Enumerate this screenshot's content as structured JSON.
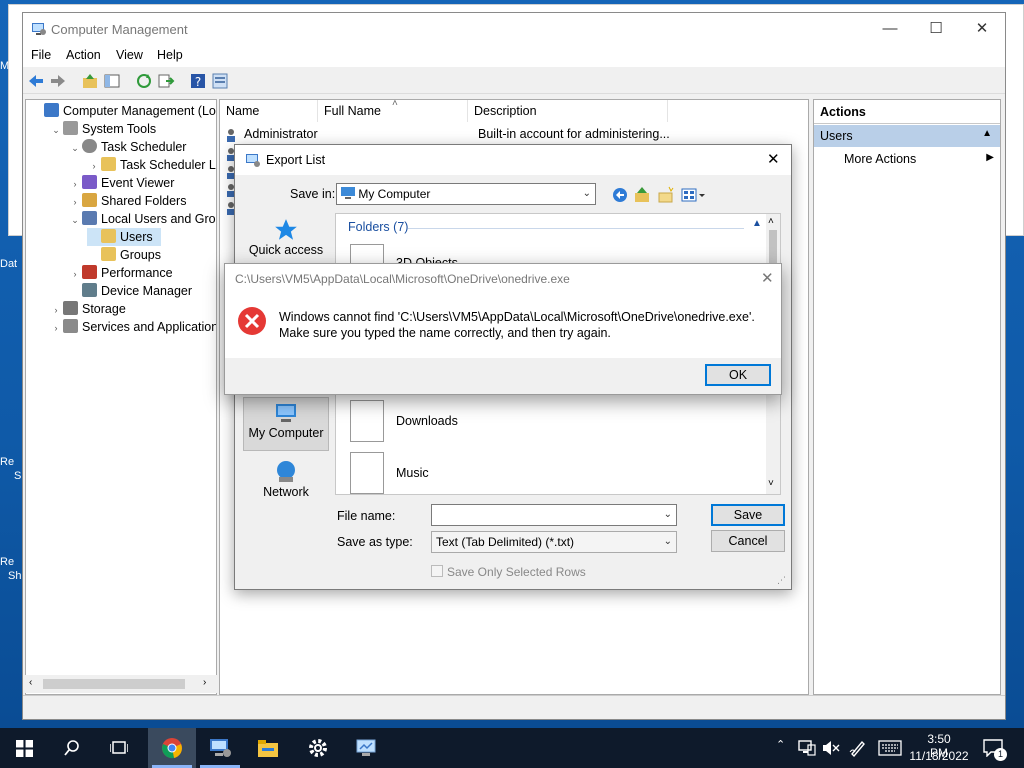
{
  "desktop": {
    "labels": [
      "M",
      "Dat",
      "Re",
      "S",
      "Re",
      "Sh"
    ]
  },
  "window": {
    "title": "Computer Management",
    "min": "—",
    "max": "☐",
    "close": "✕"
  },
  "menu": [
    "File",
    "Action",
    "View",
    "Help"
  ],
  "tree": [
    {
      "label": "Computer Management (Local",
      "exp": "",
      "indent": 0,
      "icon": "computer-management-icon"
    },
    {
      "label": "System Tools",
      "exp": "⌄",
      "indent": 1,
      "icon": "tools-icon"
    },
    {
      "label": "Task Scheduler",
      "exp": "⌄",
      "indent": 2,
      "icon": "clock-icon"
    },
    {
      "label": "Task Scheduler Libra",
      "exp": "›",
      "indent": 3,
      "icon": "folder-icon"
    },
    {
      "label": "Event Viewer",
      "exp": "›",
      "indent": 2,
      "icon": "event-viewer-icon"
    },
    {
      "label": "Shared Folders",
      "exp": "›",
      "indent": 2,
      "icon": "shared-folder-icon"
    },
    {
      "label": "Local Users and Groups",
      "exp": "⌄",
      "indent": 2,
      "icon": "users-icon"
    },
    {
      "label": "Users",
      "exp": "",
      "indent": 3,
      "icon": "folder-icon",
      "selected": true
    },
    {
      "label": "Groups",
      "exp": "",
      "indent": 3,
      "icon": "folder-icon"
    },
    {
      "label": "Performance",
      "exp": "›",
      "indent": 2,
      "icon": "performance-icon"
    },
    {
      "label": "Device Manager",
      "exp": "",
      "indent": 2,
      "icon": "device-manager-icon"
    },
    {
      "label": "Storage",
      "exp": "›",
      "indent": 1,
      "icon": "storage-icon"
    },
    {
      "label": "Services and Applications",
      "exp": "›",
      "indent": 1,
      "icon": "services-icon"
    }
  ],
  "list": {
    "columns": [
      "Name",
      "Full Name",
      "Description"
    ],
    "rows": [
      {
        "name": "Administrator",
        "full_name": "",
        "description": "Built-in account for administering..."
      }
    ]
  },
  "actions": {
    "header": "Actions",
    "section": "Users",
    "item": "More Actions"
  },
  "export": {
    "title": "Export List",
    "save_in_label": "Save in:",
    "save_in_value": "My Computer",
    "places": [
      "Quick access",
      "My Computer",
      "Network"
    ],
    "group_header": "Folders (7)",
    "folders": [
      "3D Objects",
      "Downloads",
      "Music"
    ],
    "file_name_label": "File name:",
    "file_name_value": "",
    "save_type_label": "Save as type:",
    "save_type_value": "Text (Tab Delimited) (*.txt)",
    "save_btn": "Save",
    "cancel_btn": "Cancel",
    "only_selected": "Save Only Selected Rows"
  },
  "error": {
    "title": "C:\\Users\\VM5\\AppData\\Local\\Microsoft\\OneDrive\\onedrive.exe",
    "line1": "Windows cannot find 'C:\\Users\\VM5\\AppData\\Local\\Microsoft\\OneDrive\\onedrive.exe'.",
    "line2": "Make sure you typed the name correctly, and then try again.",
    "ok": "OK"
  },
  "taskbar": {
    "time": "3:50 PM",
    "date": "11/18/2022",
    "notif_count": "1"
  }
}
